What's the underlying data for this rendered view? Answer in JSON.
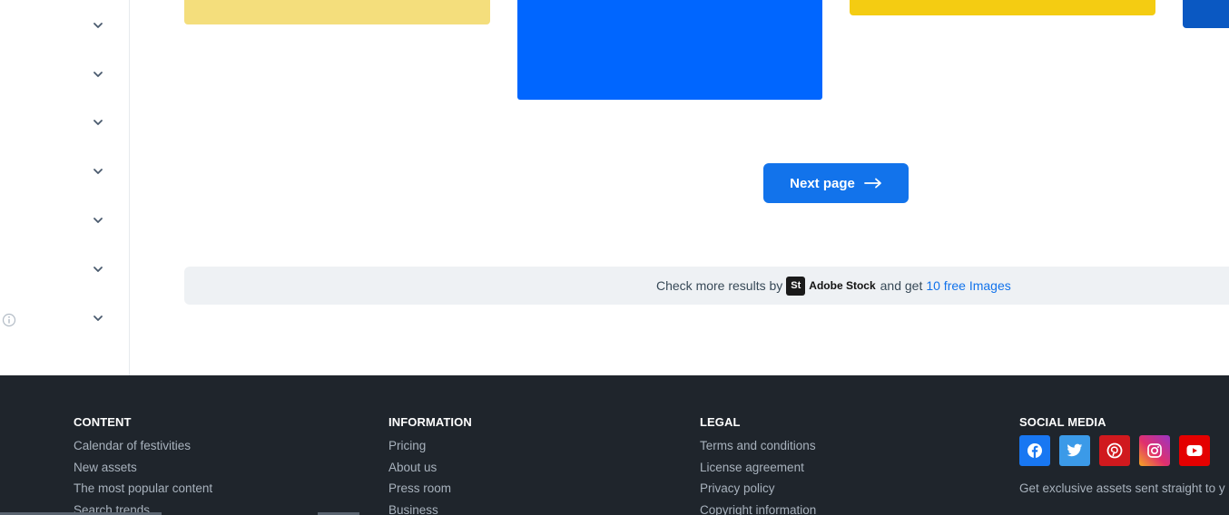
{
  "sidebar": {
    "filters": [
      {
        "icon": "chevron-down-icon"
      },
      {
        "icon": "chevron-down-icon"
      },
      {
        "icon": "chevron-down-icon"
      },
      {
        "icon": "chevron-down-icon"
      },
      {
        "icon": "chevron-down-icon"
      },
      {
        "icon": "chevron-down-icon"
      },
      {
        "icon": "chevron-down-icon"
      }
    ],
    "info_icon": "info-icon"
  },
  "results": {
    "thumbnails": [
      {
        "color": "#f4de7c"
      },
      {
        "color": "#0066ff"
      },
      {
        "color": "#f4cc12"
      },
      {
        "color": "#0a58c2"
      }
    ],
    "next_page_label": "Next page",
    "next_icon": "arrow-right-icon"
  },
  "banner": {
    "prefix": "Check more results by",
    "logo_letters": "St",
    "brand": "Adobe Stock",
    "middle": "and get",
    "link": "10 free Images"
  },
  "footer": {
    "content": {
      "heading": "CONTENT",
      "links": [
        "Calendar of festivities",
        "New assets",
        "The most popular content",
        "Search trends"
      ]
    },
    "information": {
      "heading": "INFORMATION",
      "links": [
        "Pricing",
        "About us",
        "Press room",
        "Business"
      ]
    },
    "legal": {
      "heading": "LEGAL",
      "links": [
        "Terms and conditions",
        "License agreement",
        "Privacy policy",
        "Copyright information"
      ]
    },
    "social": {
      "heading": "SOCIAL MEDIA",
      "networks": [
        {
          "icon": "facebook-icon",
          "color": "#1877f2"
        },
        {
          "icon": "twitter-icon",
          "color": "#3b9ae8"
        },
        {
          "icon": "pinterest-icon",
          "color": "#d0191e"
        },
        {
          "icon": "instagram-icon",
          "color": "#e1306c"
        },
        {
          "icon": "youtube-icon",
          "color": "#e40000"
        }
      ],
      "newsletter_text": "Get exclusive assets sent straight to y"
    }
  },
  "colors": {
    "accent": "#1273eb",
    "footer_bg": "#1f252c",
    "footer_link": "#a8b2bd",
    "banner_bg": "#eef1f4"
  }
}
